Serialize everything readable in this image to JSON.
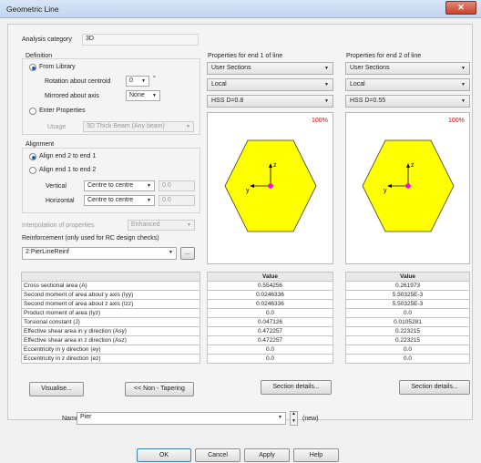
{
  "window": {
    "title": "Geometric Line",
    "close_glyph": "✕"
  },
  "analysis": {
    "label": "Analysis category",
    "value": "3D"
  },
  "definition": {
    "group_label": "Definition",
    "from_library_label": "From Library",
    "rotation_label": "Rotation about centroid",
    "rotation_value": "0",
    "rotation_unit": "°",
    "mirrored_label": "Mirrored about axis",
    "mirrored_value": "None",
    "enter_properties_label": "Enter Properties",
    "usage_label": "Usage",
    "usage_value": "3D Thick Beam (Any beam)"
  },
  "alignment": {
    "group_label": "Alignment",
    "align_2_to_1_label": "Align end 2 to end 1",
    "align_1_to_2_label": "Align end 1 to end 2",
    "vertical_label": "Vertical",
    "vertical_value": "Centre to centre",
    "vertical_offset": "0.0",
    "horizontal_label": "Horizontal",
    "horizontal_value": "Centre to centre",
    "horizontal_offset": "0.0"
  },
  "interpolation": {
    "label": "Interpolation of properties",
    "value": "Enhanced"
  },
  "reinforcement": {
    "label": "Reinforcement (only used for RC design checks)",
    "value": "2:PierLineReinf",
    "browse_label": "..."
  },
  "end1": {
    "header": "Properties for end 1 of line",
    "source": "User Sections",
    "coords": "Local",
    "section": "HSS D=0.8",
    "zoom": "100%",
    "axis_z": "z",
    "axis_y": "y",
    "values": [
      "0.554256",
      "0.0246336",
      "0.0246336",
      "0.0",
      "0.047126",
      "0.472257",
      "0.472257",
      "0.0",
      "0.0"
    ]
  },
  "end2": {
    "header": "Properties for end 2 of line",
    "source": "User Sections",
    "coords": "Local",
    "section": "HSS D=0.55",
    "zoom": "100%",
    "axis_z": "z",
    "axis_y": "y",
    "values": [
      "0.261973",
      "5.50325E-3",
      "5.50325E-3",
      "0.0",
      "0.0105281",
      "0.223215",
      "0.223215",
      "0.0",
      "0.0"
    ]
  },
  "table": {
    "value_header": "Value",
    "properties": [
      "Cross sectional area (A)",
      "Second moment of area about y axis (Iyy)",
      "Second moment of area about z axis (Izz)",
      "Product moment of area (Iyz)",
      "Torsional constant (J)",
      "Effective shear area in y direction (Asy)",
      "Effective shear area in z direction (Asz)",
      "Eccentricity in y direction (ey)",
      "Eccentricity in z direction (ez)"
    ]
  },
  "buttons": {
    "visualise": "Visualise...",
    "non_tapering": "<< Non - Tapering",
    "section_details_1": "Section details...",
    "section_details_2": "Section details...",
    "ok": "OK",
    "cancel": "Cancel",
    "apply": "Apply",
    "help": "Help"
  },
  "name": {
    "label": "Name",
    "value": "Pier",
    "suffix": "(new)"
  },
  "colors": {
    "section_fill": "#ffff00",
    "centroid": "#ff00ff",
    "accent": "#1d5fb8"
  }
}
